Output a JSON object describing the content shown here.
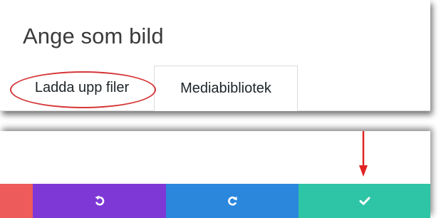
{
  "dialog": {
    "title": "Ange som bild",
    "tabs": [
      {
        "label": "Ladda upp filer",
        "active": false,
        "highlighted": true
      },
      {
        "label": "Mediabibliotek",
        "active": true
      }
    ]
  },
  "toolbar": {
    "buttons": [
      {
        "name": "delete",
        "icon": "none",
        "color": "#ee5b5b"
      },
      {
        "name": "undo",
        "icon": "undo-icon",
        "color": "#7e38d6"
      },
      {
        "name": "redo",
        "icon": "redo-icon",
        "color": "#2b87dc"
      },
      {
        "name": "confirm",
        "icon": "check-icon",
        "color": "#2ec4a6"
      }
    ]
  },
  "annotations": {
    "highlight_color": "#d63638"
  }
}
